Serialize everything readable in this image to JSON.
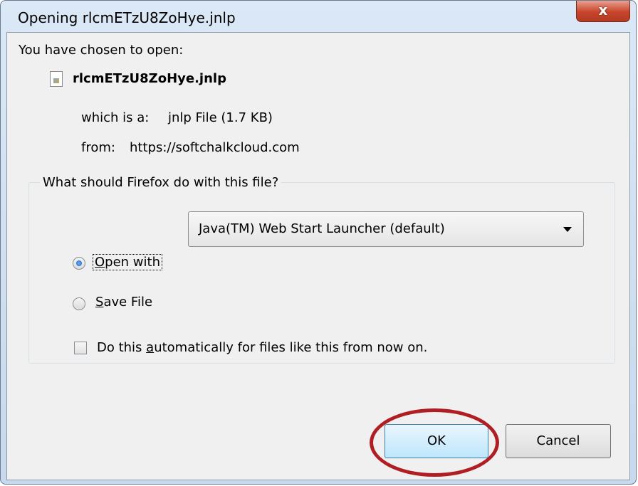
{
  "window": {
    "title": "Opening rlcmETzU8ZoHye.jnlp",
    "close_label": "x"
  },
  "dialog": {
    "intro": "You have chosen to open:",
    "file_name": "rlcmETzU8ZoHye.jnlp",
    "type_label": "which is a:",
    "type_value": "jnlp File (1.7 KB)",
    "from_label": "from:",
    "from_value": "https://softchalkcloud.com"
  },
  "group": {
    "label": "What should Firefox do with this file?",
    "open_with": {
      "label_prefix": "",
      "accel": "O",
      "label_rest": "pen with",
      "checked": true,
      "selected_app": "Java(TM) Web Start Launcher (default)"
    },
    "save_file": {
      "accel": "S",
      "label_rest": "ave File",
      "checked": false
    },
    "auto": {
      "label_before": "Do this ",
      "accel": "a",
      "label_after": "utomatically for files like this from now on.",
      "checked": false
    }
  },
  "buttons": {
    "ok": "OK",
    "cancel": "Cancel"
  },
  "colors": {
    "highlight_ring": "#b01e24",
    "close_button": "#c7442b"
  }
}
